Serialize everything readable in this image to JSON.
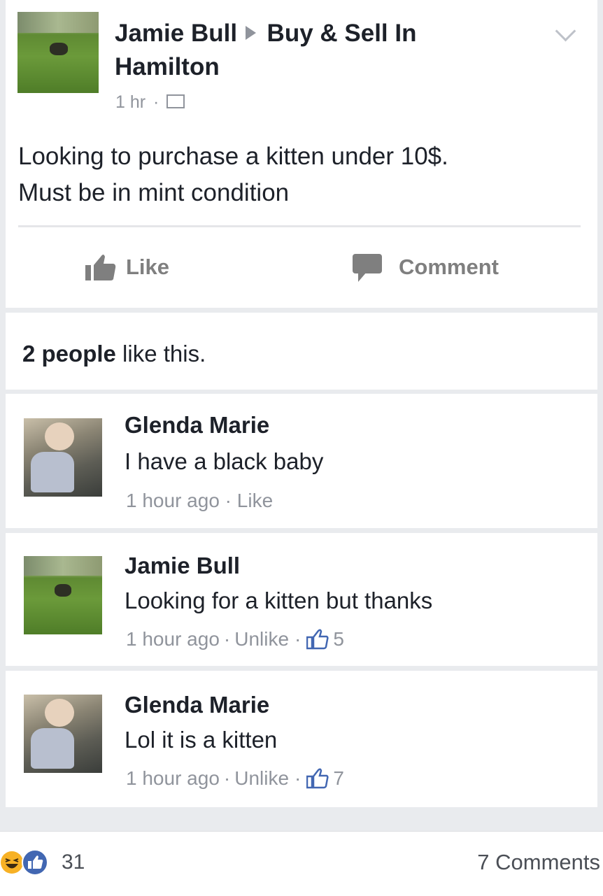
{
  "post": {
    "author": "Jamie Bull",
    "group_line1": "Buy & Sell In",
    "group_line2": "Hamilton",
    "time": "1 hr",
    "text_line1": "Looking to purchase a kitten under 10$.",
    "text_line2": "Must be in mint condition",
    "like_label": "Like",
    "comment_label": "Comment"
  },
  "likes_summary": {
    "count_text": "2 people",
    "rest_text": " like this."
  },
  "comments": [
    {
      "author": "Glenda Marie",
      "text": "I have a black baby",
      "time": "1 hour ago",
      "action": "Like",
      "likes": ""
    },
    {
      "author": "Jamie Bull",
      "text": "Looking for a kitten but thanks",
      "time": "1 hour ago",
      "action": "Unlike",
      "likes": "5"
    },
    {
      "author": "Glenda Marie",
      "text": "Lol it is a kitten",
      "time": "1 hour ago",
      "action": "Unlike",
      "likes": "7"
    }
  ],
  "footer": {
    "reactions_count": "31",
    "comments_count": "7 Comments"
  },
  "colors": {
    "like_blue": "#4267b2",
    "meta_gray": "#90949c",
    "haha_yellow": "#f7b125"
  }
}
